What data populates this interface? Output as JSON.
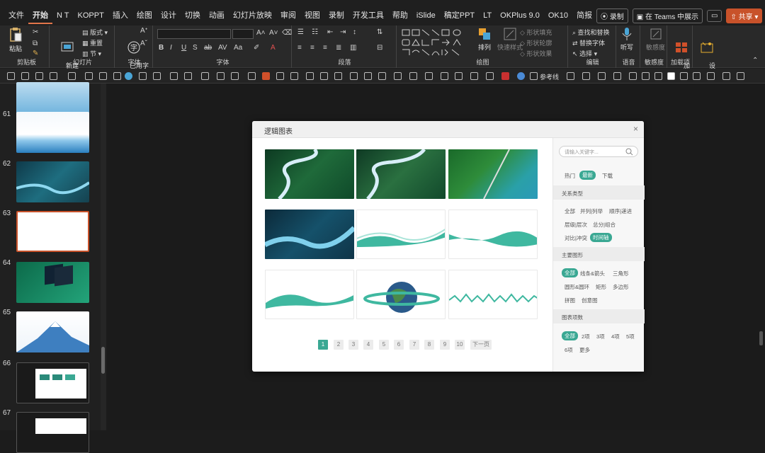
{
  "menu": {
    "tabs": [
      "文件",
      "开始",
      "N T",
      "KOPPT",
      "插入",
      "绘图",
      "设计",
      "切换",
      "动画",
      "幻灯片放映",
      "审阅",
      "视图",
      "录制",
      "开发工具",
      "帮助",
      "iSlide",
      "稿定PPT",
      "LT",
      "OKPlus 9.0",
      "OK10",
      "简报"
    ],
    "record": "录制",
    "teams": "在 Teams 中展示",
    "share": "共享"
  },
  "ribbon": {
    "paste": "粘贴",
    "clipboard": "剪贴板",
    "new_slide": "新建\n幻灯片",
    "layout": "版式",
    "reset": "重置",
    "section": "节",
    "slides": "幻灯片",
    "font_used": "已用字\n体",
    "font_group": "字体",
    "font_group2": "字体",
    "paragraph": "段落",
    "arrange": "排列",
    "quick_style": "快速样式",
    "shape_fill": "形状填充",
    "shape_outline": "形状轮廓",
    "shape_effect": "形状效果",
    "drawing": "绘图",
    "find_replace": "查找和替换",
    "replace_font": "替换字体",
    "select": "选择",
    "editing": "编辑",
    "dictate": "听写",
    "voice": "语音",
    "sensitivity": "敏感度",
    "sensitivity_group": "敏感度",
    "addins": "加\n载项",
    "addins_group": "加载项",
    "designer": "设\n计器"
  },
  "qat": {
    "ref_line": "参考线"
  },
  "slides": [
    {
      "num": "61"
    },
    {
      "num": "62"
    },
    {
      "num": "63"
    },
    {
      "num": "64"
    },
    {
      "num": "65"
    },
    {
      "num": "66"
    },
    {
      "num": "67"
    }
  ],
  "dialog": {
    "title": "逻辑图表",
    "close": "×",
    "search_placeholder": "请输入关键字...",
    "tabs": [
      "热门",
      "最新",
      "下载"
    ],
    "relation_header": "关系类型",
    "relations": [
      "全部",
      "并列|列举",
      "顺序|递进",
      "层级|层次",
      "总分|组合",
      "对比|冲突",
      "时间轴"
    ],
    "shape_header": "主要图形",
    "shapes": [
      "全部",
      "线条&箭头",
      "三角形",
      "圆形&圆环",
      "矩形",
      "多边形",
      "拼图",
      "创意图"
    ],
    "count_header": "图表项数",
    "counts": [
      "全部",
      "2项",
      "3项",
      "4项",
      "5项",
      "6项",
      "更多"
    ],
    "pages": [
      "1",
      "2",
      "3",
      "4",
      "5",
      "6",
      "7",
      "8",
      "9",
      "10"
    ],
    "next": "下一页"
  }
}
